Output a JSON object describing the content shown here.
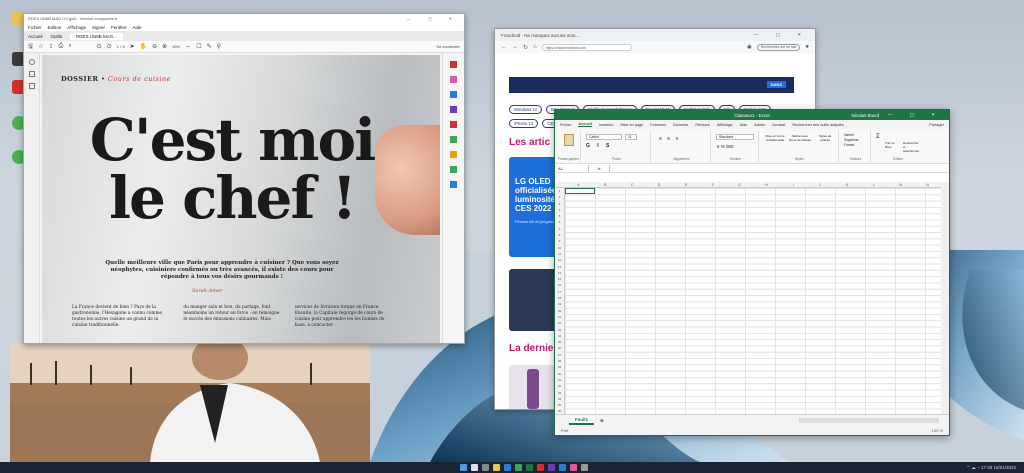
{
  "pdf": {
    "title": "RDES UN8B MAG D'Cgold - Version compactée.fr",
    "menu": [
      "Fichier",
      "Edition",
      "Affichage",
      "Signer",
      "Fenêtre",
      "Aide"
    ],
    "tabs": [
      "Accueil",
      "Outils",
      "RDES UN8B MAG..."
    ],
    "page_counter": "1 / 3",
    "zoom": "18%",
    "comment_label": "Se connecter",
    "article": {
      "section": "DOSSIER",
      "subsection": "Cours de cuisine",
      "headline_line1": "C'est moi",
      "headline_line2": "le chef !",
      "lead": "Quelle meilleure ville que Paris pour apprendre à cuisiner ? Que vous soyez néophytes, cuisiniers confirmés ou très avancés, il existe des cours pour répondre à tous vos désirs gourmands !",
      "author": "Sarah Amer",
      "col1": "La France devient de bien ? Pays de la gastronomie, l'Hexagone a connu comme toutes les autres cuisine un grand de la cuisine traditionnelle.",
      "col2": "du manger sain et bon, du partage, font néanmoins un retour en force : en témoigne le succès des émissions culinaires. Mais",
      "col3": "services de livraison torque en France. Ensuite, la Capitale regorge de cours de cuisine pour apprendre les les bonnes de base, à concocter"
    }
  },
  "browser": {
    "tab_title": "Frandroid - Ne manquez aucune actu...",
    "url": "https://www.frandroid.com",
    "search_placeholder": "Recherchez sur ce site",
    "banner_logo": "DANS",
    "chips": [
      "Windows 11",
      "Box Internet",
      "Meilleurs smartphones",
      "Xiaomi Mi 11",
      "Forfait mobile",
      "5G",
      "Galaxy A52",
      "iPhone 13",
      "CES 2022"
    ],
    "section1": "Les artic",
    "card_title": "LG OLED officialisée luminosité CES 2022",
    "card_sub": "Pensez A2 et programme",
    "section2": "La dernie"
  },
  "excel": {
    "title": "Classeur1 - Excel",
    "user": "Nicolas Bocof",
    "menu": [
      "Fichier",
      "Accueil",
      "Insertion",
      "Mise en page",
      "Formules",
      "Données",
      "Révision",
      "Affichage",
      "Aide",
      "Adobe",
      "Acrobat",
      "Rechercher des outils adaptés"
    ],
    "share": "Partager",
    "groups": [
      "Presse-papiers",
      "Police",
      "Alignement",
      "Nombre",
      "Styles",
      "Cellules",
      "Édition"
    ],
    "font_name": "Calibri",
    "font_size": "11",
    "number_format": "Standard",
    "styles_btn": [
      "Mise en forme conditionnelle",
      "Mettre sous forme de tableau",
      "Styles de cellules"
    ],
    "cells_btn": [
      "Insérer",
      "Supprimer",
      "Format"
    ],
    "edit_btn": [
      "Trier et filtrer",
      "Rechercher et sélectionner"
    ],
    "name_box": "A1",
    "fx": "fx",
    "columns": [
      "A",
      "B",
      "C",
      "D",
      "E",
      "F",
      "G",
      "H",
      "I",
      "J",
      "K",
      "L",
      "M",
      "N"
    ],
    "rows": [
      "1",
      "2",
      "3",
      "4",
      "5",
      "6",
      "7",
      "8",
      "9",
      "10",
      "11",
      "12",
      "13",
      "14",
      "15",
      "16",
      "17",
      "18",
      "19",
      "20",
      "21",
      "22",
      "23",
      "24",
      "25",
      "26",
      "27",
      "28",
      "29",
      "30",
      "31",
      "32",
      "33",
      "34",
      "35",
      "36",
      "37"
    ],
    "sheet_tab": "Feuil1",
    "status_left": "Prêt",
    "zoom": "100 %"
  },
  "taskbar": {
    "time": "17:48",
    "date": "15/01/2022"
  },
  "colors": {
    "excel_green": "#217346",
    "frandroid_blue": "#1e6fd9",
    "frandroid_pink": "#c0186b",
    "cooking_red": "#c0392b"
  }
}
